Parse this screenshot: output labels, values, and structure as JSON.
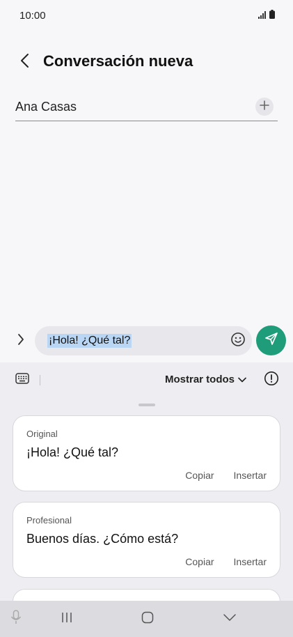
{
  "status_bar": {
    "time": "10:00"
  },
  "header": {
    "title": "Conversación nueva"
  },
  "recipient": {
    "name": "Ana Casas"
  },
  "composer": {
    "message": "¡Hola! ¿Qué tal?"
  },
  "panel": {
    "show_all_label": "Mostrar todos",
    "suggestions": [
      {
        "label": "Original",
        "text": "¡Hola! ¿Qué tal?",
        "copy_label": "Copiar",
        "insert_label": "Insertar"
      },
      {
        "label": "Profesional",
        "text": "Buenos días. ¿Cómo está?",
        "copy_label": "Copiar",
        "insert_label": "Insertar"
      }
    ]
  },
  "icons": {
    "back": "chevron-left-icon",
    "add": "plus-icon",
    "expand": "chevron-right-icon",
    "emoji": "smiley-icon",
    "send": "paper-plane-icon",
    "keyboard": "keyboard-icon",
    "dropdown": "chevron-down-icon",
    "info": "alert-circle-icon",
    "mic": "microphone-icon",
    "recents": "recents-icon",
    "home": "home-icon",
    "hide_keyboard": "chevron-down-icon"
  },
  "colors": {
    "send_button": "#1f9d7a",
    "text_selection": "#b9d6f5",
    "background": "#f7f7f9",
    "panel": "#eeeef2"
  }
}
